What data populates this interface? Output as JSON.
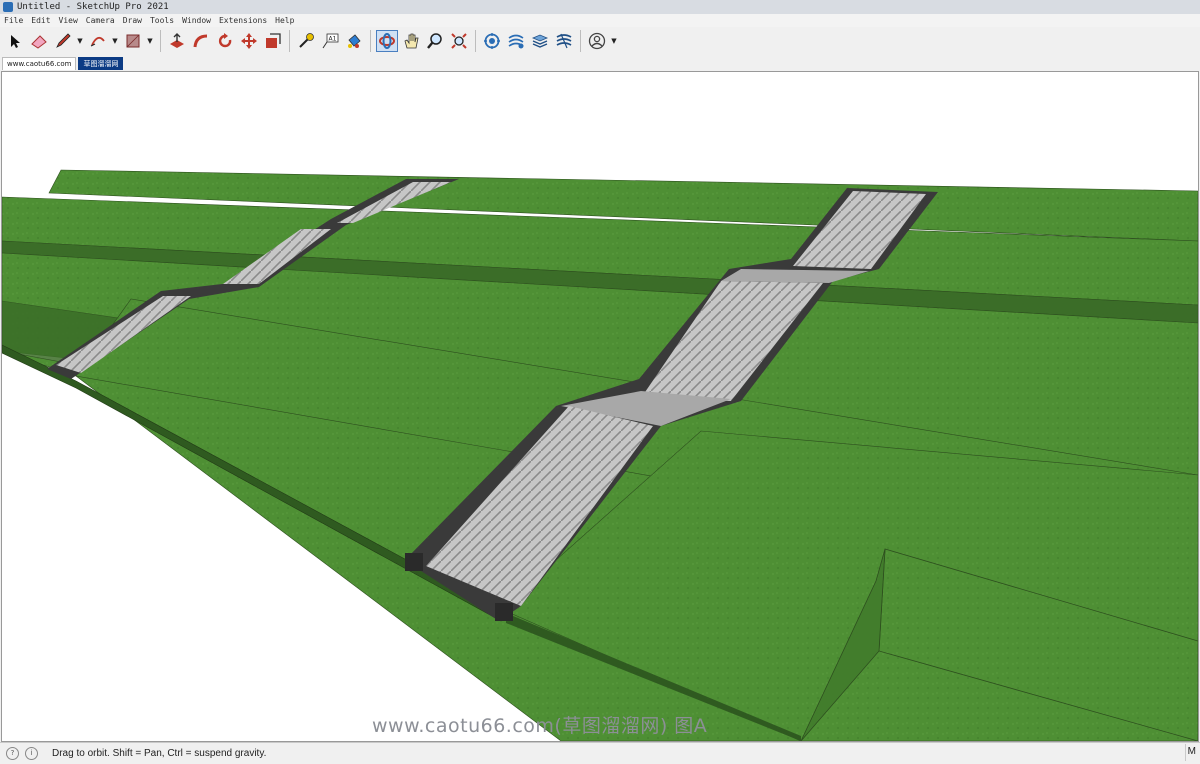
{
  "window": {
    "title": "Untitled - SketchUp Pro 2021"
  },
  "menu": {
    "items": [
      "File",
      "Edit",
      "View",
      "Camera",
      "Draw",
      "Tools",
      "Window",
      "Extensions",
      "Help"
    ]
  },
  "toolbar": {
    "tools": [
      "select-icon",
      "eraser-icon",
      "pencil-icon",
      "arc-icon",
      "rectangle-icon",
      "push-pull-icon",
      "follow-me-icon",
      "rotate-icon",
      "move-icon",
      "offset-icon",
      "tape-measure-icon",
      "text-icon",
      "paint-bucket-icon",
      "orbit-icon",
      "pan-icon",
      "zoom-icon",
      "zoom-extents-icon",
      "geo-location-icon",
      "sandbox-icon",
      "layers-icon",
      "terrain-icon",
      "account-icon"
    ]
  },
  "tabs": [
    {
      "label": "www.caotu66.com"
    },
    {
      "label": "草图溜溜网"
    }
  ],
  "viewport": {
    "watermark": "www.caotu66.com(草图溜溜网) 图A"
  },
  "status": {
    "hint": "Drag to orbit. Shift = Pan, Ctrl = suspend gravity.",
    "measurements_label": "M"
  },
  "colors": {
    "grass": "#4e8f34",
    "grass_dark": "#3b6d28",
    "stair_concrete": "#b9b9b9",
    "stair_edge": "#3a3a3a",
    "accent": "#0c3b84"
  }
}
